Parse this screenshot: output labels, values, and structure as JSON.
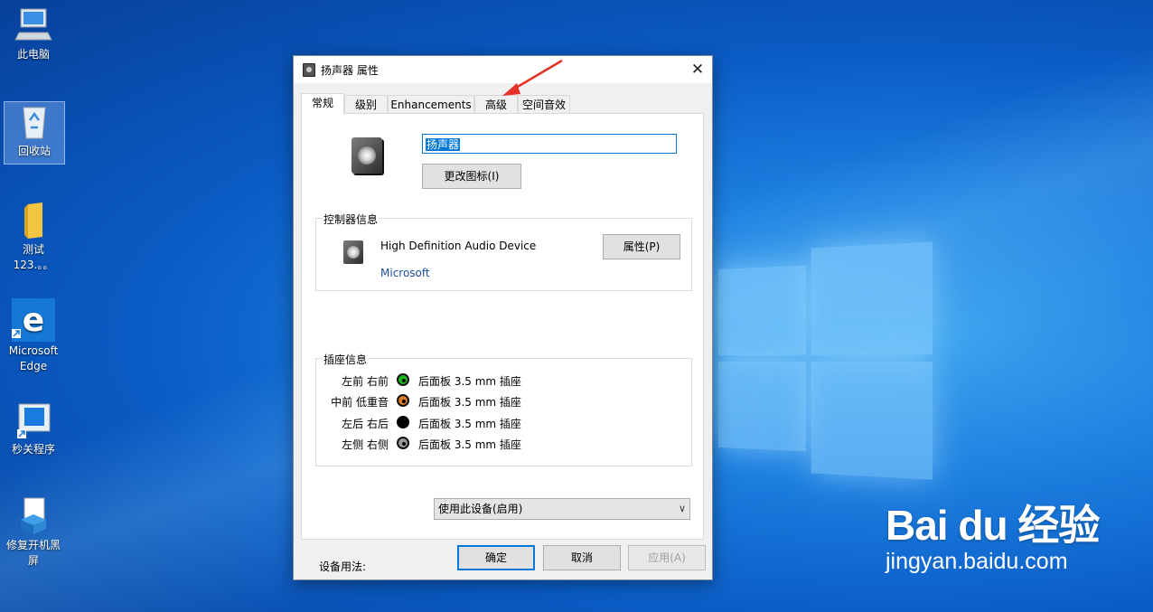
{
  "desktop": {
    "icons": [
      {
        "label": "此电脑"
      },
      {
        "label": "回收站"
      },
      {
        "label": "测试123.。。"
      },
      {
        "label": "Microsoft Edge"
      },
      {
        "label": "秒关程序"
      },
      {
        "label": "修复开机黑屏"
      }
    ]
  },
  "dialog": {
    "title": "扬声器 属性",
    "close": "✕",
    "tabs": [
      "常规",
      "级别",
      "Enhancements",
      "高级",
      "空间音效"
    ],
    "active_tab": "常规",
    "device_name": "扬声器",
    "change_icon_label": "更改图标(I)",
    "controller": {
      "title": "控制器信息",
      "device": "High Definition Audio Device",
      "vendor": "Microsoft",
      "properties_label": "属性(P)"
    },
    "jacks": {
      "title": "插座信息",
      "rows": [
        {
          "label": "左前 右前",
          "color": "#1bb81b",
          "text": "后面板 3.5 mm 插座"
        },
        {
          "label": "中前 低重音",
          "color": "#d97a1e",
          "text": "后面板 3.5 mm 插座"
        },
        {
          "label": "左后 右后",
          "color": "#000000",
          "text": "后面板 3.5 mm 插座"
        },
        {
          "label": "左侧 右侧",
          "color": "#9a9a9a",
          "text": "后面板 3.5 mm 插座"
        }
      ]
    },
    "usage_label": "设备用法:",
    "usage_value": "使用此设备(启用)",
    "ok_label": "确定",
    "cancel_label": "取消",
    "apply_label": "应用(A)"
  },
  "watermark": {
    "logo": "Bai du 经验",
    "url": "jingyan.baidu.com"
  },
  "colors": {
    "accent": "#0078d7",
    "annotation_arrow": "#e8302a"
  }
}
